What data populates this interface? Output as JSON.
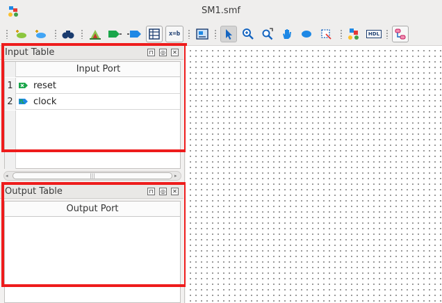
{
  "window": {
    "title": "SM1.smf"
  },
  "toolbar": {
    "icons": [
      "add-state-icon",
      "add-transition-icon",
      "find-icon",
      "hierarchy-icon",
      "input-port-icon",
      "output-port-icon",
      "table-icon",
      "variable-icon",
      "export-icon",
      "select-pointer-icon",
      "zoom-in-icon",
      "zoom-fit-icon",
      "pan-hand-icon",
      "ellipse-icon",
      "region-icon",
      "simulate-icon",
      "hdl-icon",
      "state-machine-view-icon"
    ],
    "variable_label": "x=b",
    "hdl_label": "HDL"
  },
  "input_table": {
    "title": "Input Table",
    "column_header": "Input Port",
    "rows": [
      {
        "num": "1",
        "name": "reset",
        "icon": "reset-port-icon"
      },
      {
        "num": "2",
        "name": "clock",
        "icon": "clock-port-icon"
      }
    ],
    "scroll_grip": "|||"
  },
  "output_table": {
    "title": "Output Table",
    "column_header": "Output Port",
    "rows": []
  },
  "panel_buttons": {
    "pin": "⊓",
    "float": "◎",
    "close": "✕"
  },
  "colors": {
    "highlight": "#ee1c1c",
    "accent_blue": "#1e88e5",
    "port_green": "#1aa64a"
  }
}
